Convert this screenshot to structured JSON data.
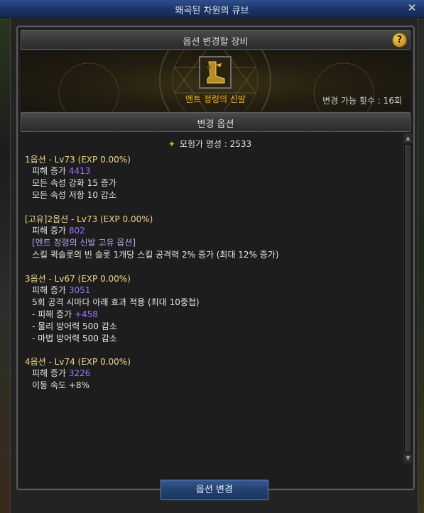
{
  "window": {
    "title": "왜곡된 차원의 큐브",
    "close_icon": "close-icon"
  },
  "header": {
    "label": "옵션 변경할 장비",
    "help": "?"
  },
  "equipment": {
    "name": "엔트 정령의 신발",
    "change_count": "변경 가능 횟수 : 16회"
  },
  "options_header": {
    "label": "변경 옵션"
  },
  "fame": {
    "text": "모험가 명성 : 2533"
  },
  "option1": {
    "title": "1옵션 - Lv73 (EXP 0.00%)",
    "dmg_label": "피해 증가",
    "dmg_value": "4413",
    "line1": "모든 속성 강화 15 증가",
    "line2": "모든 속성 저항 10 감소"
  },
  "option2": {
    "title": "[고유]2옵션 - Lv73 (EXP 0.00%)",
    "dmg_label": "피해 증가",
    "dmg_value": "802",
    "unique": "[엔트 정령의 신발 고유 옵션]",
    "line1": "스킬 퀵슬롯의 빈 슬롯 1개당 스킬 공격력 2% 증가 (최대 12% 증가)"
  },
  "option3": {
    "title": "3옵션 - Lv67 (EXP 0.00%)",
    "dmg_label": "피해 증가",
    "dmg_value": "3051",
    "line1": "5회 공격 시마다 아래 효과 적용 (최대 10중첩)",
    "sub1_label": "- 피해 증가",
    "sub1_value": "+458",
    "sub2": "- 물리 방어력 500 감소",
    "sub3": "- 마법 방어력 500 감소"
  },
  "option4": {
    "title": "4옵션 - Lv74 (EXP 0.00%)",
    "dmg_label": "피해 증가",
    "dmg_value": "3226",
    "line1": "이동 속도 +8%"
  },
  "footer": {
    "button": "옵션 변경"
  },
  "colors": {
    "gold": "#f0b326",
    "option_title": "#f0d48a",
    "value": "#a070ff"
  }
}
